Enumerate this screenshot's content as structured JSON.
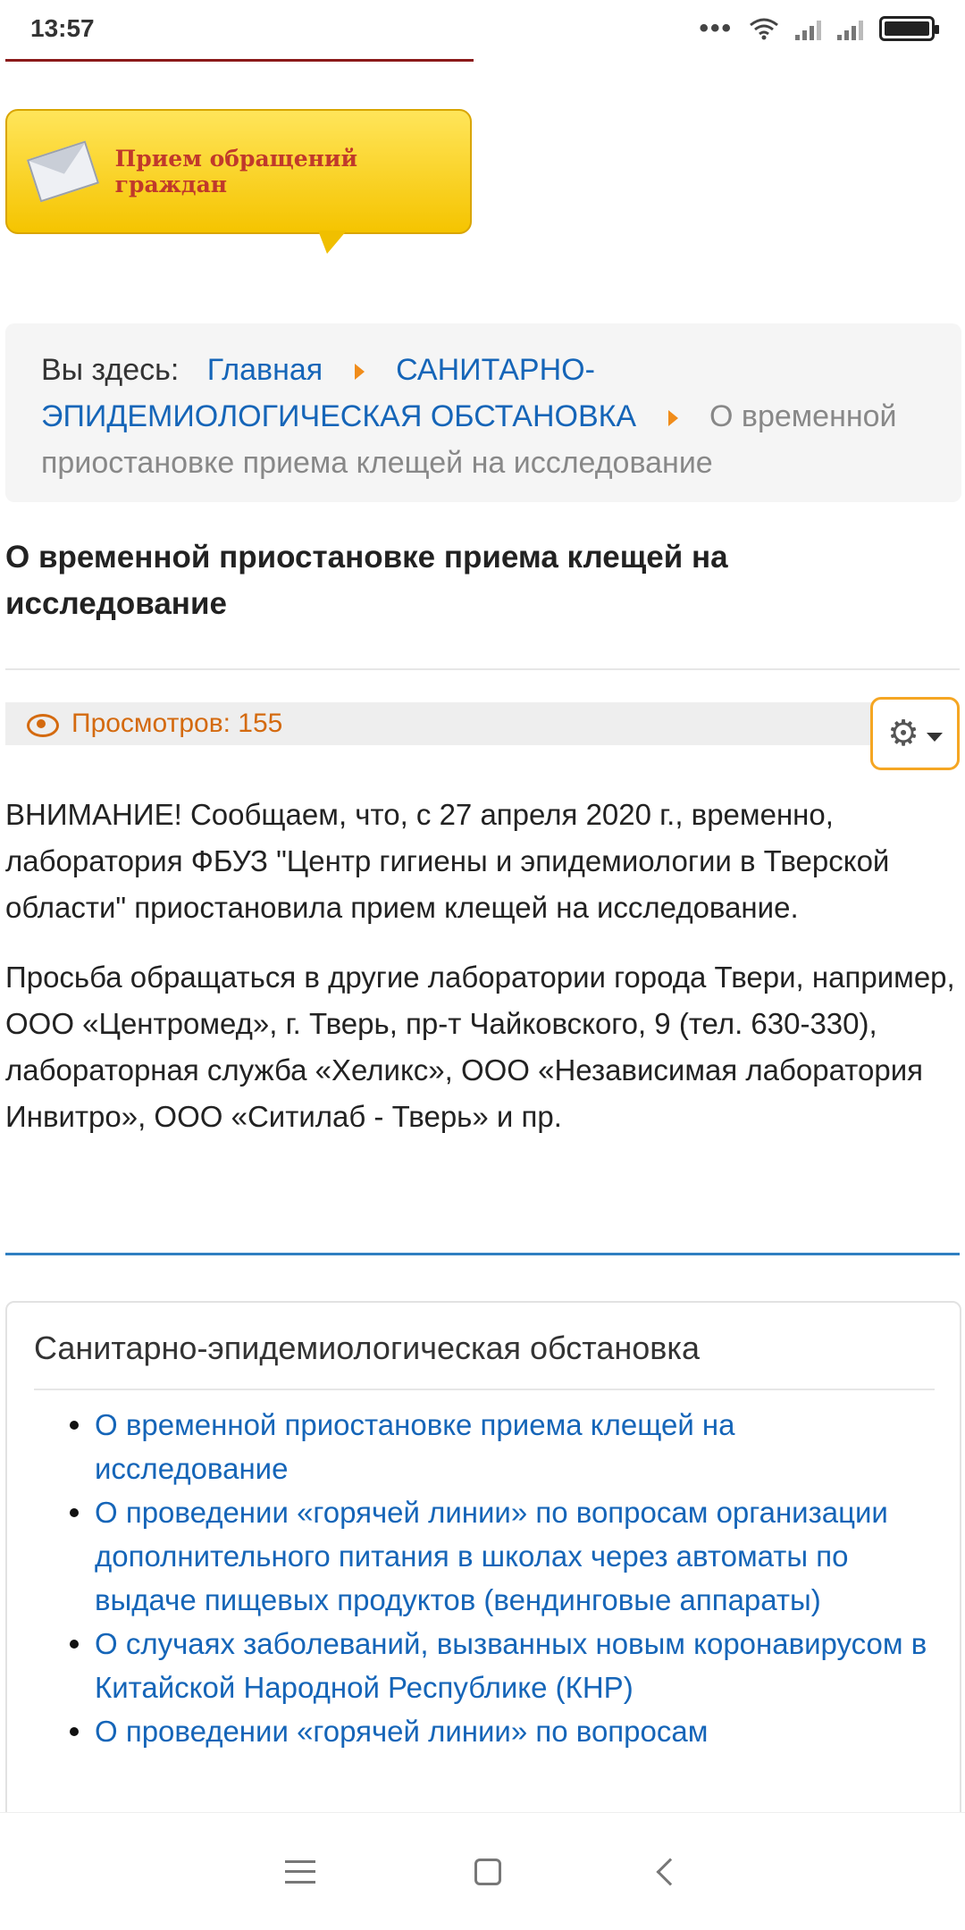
{
  "status_bar": {
    "time": "13:57"
  },
  "banner": {
    "text": "Прием обращений граждан"
  },
  "breadcrumb": {
    "label": "Вы здесь:",
    "items": [
      {
        "text": "Главная"
      },
      {
        "text": "САНИТАРНО-ЭПИДЕМИОЛОГИЧЕСКАЯ ОБСТАНОВКА"
      }
    ],
    "current": "О временной приостановке приема клещей на исследование"
  },
  "article": {
    "title": "О временной приостановке приема клещей на исследование",
    "views": "Просмотров: 155",
    "paragraphs": [
      "ВНИМАНИЕ! Сообщаем, что, с 27 апреля 2020 г., временно, лаборатория ФБУЗ \"Центр гигиены и эпидемиологии в Тверской области\" приостановила прием клещей на исследование.",
      "Просьба обращаться в другие лаборатории города Твери, например, ООО «Центромед», г. Тверь, пр-т Чайковского, 9 (тел. 630-330), лабораторная служба «Хеликс», ООО «Независимая лаборатория Инвитро»,  ООО «Ситилаб - Тверь» и пр."
    ]
  },
  "module": {
    "title": "Санитарно-эпидемиологическая обстановка",
    "items": [
      "О временной приостановке приема клещей на исследование",
      "О проведении «горячей линии» по вопросам организации дополнительного питания в школах через автоматы по выдаче пищевых продуктов (вендинговые аппараты)",
      "О случаях заболеваний, вызванных новым коронавирусом в Китайской Народной Республике (КНР)",
      "О проведении «горячей линии» по вопросам"
    ]
  },
  "colors": {
    "link": "#1565b8",
    "accent_orange": "#d46a0f",
    "separator_blue": "#2f7fc1",
    "banner_yellow": "#f5c400"
  },
  "icons": [
    "wifi-icon",
    "signal-icon",
    "battery-icon",
    "eye-icon",
    "gear-icon",
    "caret-down-icon",
    "menu-icon",
    "home-icon",
    "back-icon"
  ]
}
